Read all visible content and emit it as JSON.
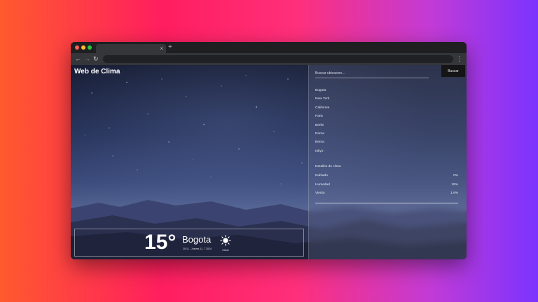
{
  "app": {
    "title": "Web de Clima"
  },
  "browser": {
    "tab_close_glyph": "×",
    "new_tab_glyph": "+",
    "icons": [
      "back-icon",
      "forward-icon",
      "reload-icon",
      "menu-icon"
    ]
  },
  "search": {
    "placeholder": "Buscar ubicacion...",
    "button_label": "Buscar"
  },
  "cities": [
    "Bogota",
    "New York",
    "California",
    "Paris",
    "Berlin",
    "Roma",
    "Berna",
    "tokyo"
  ],
  "details": {
    "title": "Detalles de clima",
    "rows": [
      {
        "label": "Nublado",
        "value": "0%"
      },
      {
        "label": "Humedad",
        "value": "18%"
      },
      {
        "label": "Viento",
        "value": "1.6%"
      }
    ]
  },
  "weather": {
    "temperature": "15°",
    "city": "Bogota",
    "datetime": "20:11 - Jueves 11, 7 2024",
    "condition": "Clear",
    "icon": "sun-icon"
  },
  "colors": {
    "accent_button": "#151515",
    "text": "#ffffff"
  }
}
